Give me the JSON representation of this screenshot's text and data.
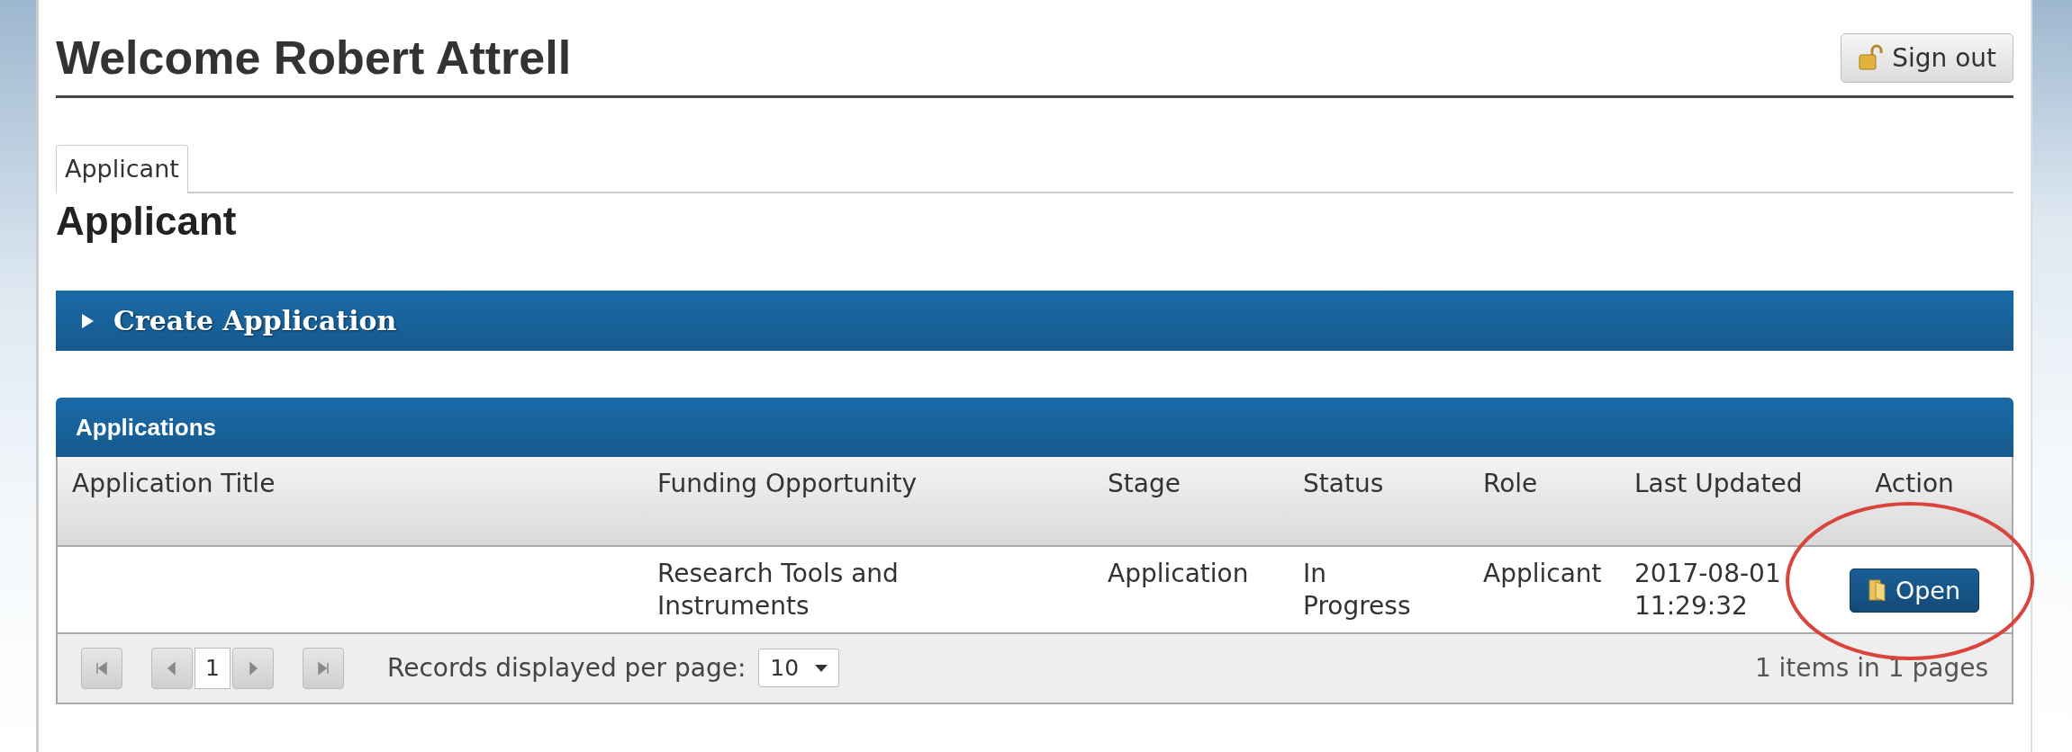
{
  "header": {
    "title": "Welcome Robert Attrell",
    "sign_out": "Sign out"
  },
  "tabs": [
    {
      "label": "Applicant",
      "selected": true
    }
  ],
  "section_title": "Applicant",
  "create_panel": {
    "title": "Create Application",
    "expanded": false
  },
  "applications": {
    "title": "Applications",
    "columns": [
      "Application Title",
      "Funding Opportunity",
      "Stage",
      "Status",
      "Role",
      "Last Updated",
      "Action"
    ],
    "rows": [
      {
        "cells": [
          "",
          "Research Tools and Instruments",
          "Application",
          "In Progress",
          "Applicant",
          "2017-08-01 11:29:32",
          "Open"
        ]
      }
    ]
  },
  "pager": {
    "page": "1",
    "per_page_label": "Records displayed per page:",
    "per_page": "10",
    "summary": "1 items in 1 pages"
  }
}
